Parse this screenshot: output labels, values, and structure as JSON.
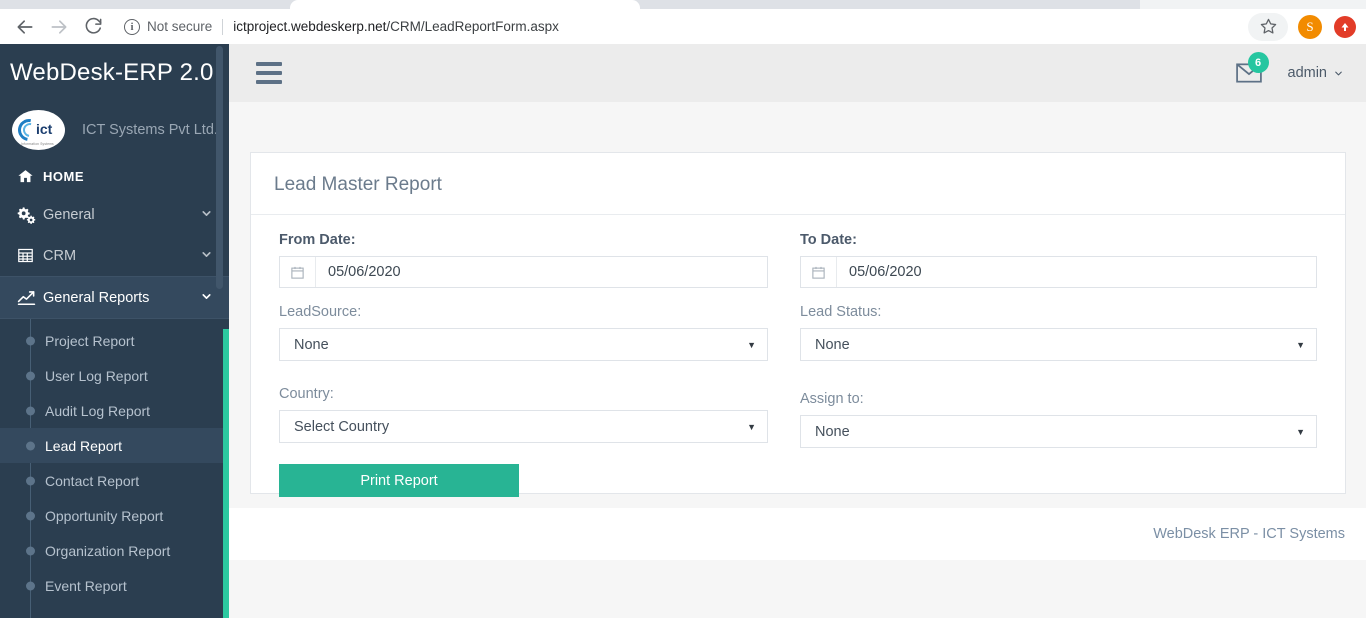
{
  "browser": {
    "security_label": "Not secure",
    "url_host": "ictproject.webdeskerp.net",
    "url_path": "/CRM/LeadReportForm.aspx",
    "url_full": "ictproject.webdeskerp.net/CRM/LeadReportForm.aspx",
    "back_icon": "back-arrow-icon",
    "forward_icon": "forward-arrow-icon",
    "reload_icon": "reload-icon",
    "info_icon": "info-circle-icon",
    "bookmark_icon": "star-icon",
    "profile_initial": "S",
    "extension_icon": "extension-icon"
  },
  "sidebar": {
    "brand": "WebDesk-ERP 2.0",
    "company": "ICT Systems Pvt Ltd.",
    "logo_text": "ict",
    "logo_tagline": "Information Systems",
    "nav": [
      {
        "label": "HOME",
        "icon": "home-icon",
        "caret": ""
      },
      {
        "label": "General",
        "icon": "gears-icon",
        "caret": "⌄"
      },
      {
        "label": "CRM",
        "icon": "grid-icon",
        "caret": "⌄"
      },
      {
        "label": "General Reports",
        "icon": "chart-line-icon",
        "caret": "⌄"
      }
    ],
    "submenu": [
      {
        "label": "Project Report",
        "active": false
      },
      {
        "label": "User Log Report",
        "active": false
      },
      {
        "label": "Audit Log Report",
        "active": false
      },
      {
        "label": "Lead Report",
        "active": true
      },
      {
        "label": "Contact Report",
        "active": false
      },
      {
        "label": "Opportunity Report",
        "active": false
      },
      {
        "label": "Organization Report",
        "active": false
      },
      {
        "label": "Event Report",
        "active": false
      }
    ],
    "accent_color": "#2cc9a0",
    "bg_color": "#2b3e50"
  },
  "topbar": {
    "menu_toggle_icon": "hamburger-icon",
    "mail_icon": "envelope-icon",
    "mail_badge": "6",
    "user_name": "admin",
    "user_caret": "⌄"
  },
  "main": {
    "card_title": "Lead Master Report",
    "fields": {
      "from_date": {
        "label": "From Date:",
        "value": "05/06/2020",
        "icon": "calendar-icon"
      },
      "to_date": {
        "label": "To Date:",
        "value": "05/06/2020",
        "icon": "calendar-icon"
      },
      "lead_source": {
        "label": "LeadSource:",
        "value": "None"
      },
      "lead_status": {
        "label": "Lead Status:",
        "value": "None"
      },
      "country": {
        "label": "Country:",
        "value": "Select Country"
      },
      "assign_to": {
        "label": "Assign to:",
        "value": "None"
      }
    },
    "print_button": "Print Report",
    "print_button_color": "#28b494"
  },
  "footer": {
    "text": "WebDesk ERP - ICT Systems"
  }
}
